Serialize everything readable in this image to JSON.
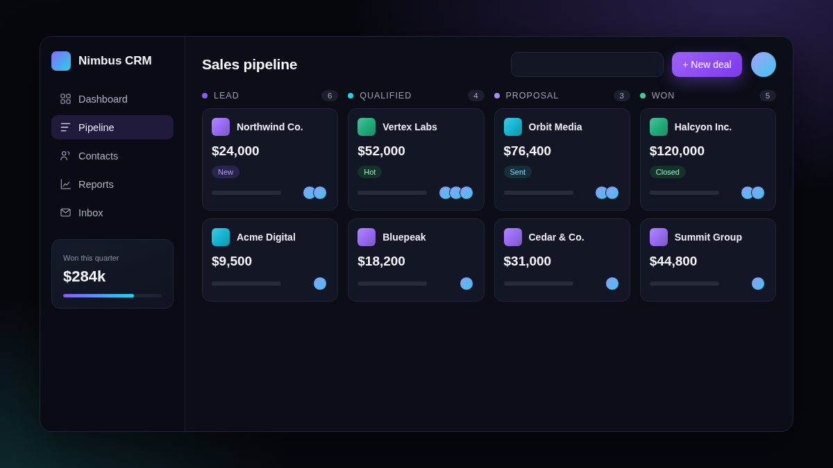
{
  "app": {
    "name": "Nimbus CRM"
  },
  "sidebar": {
    "items": [
      {
        "label": "Dashboard",
        "selected": false
      },
      {
        "label": "Pipeline",
        "selected": true
      },
      {
        "label": "Contacts",
        "selected": false
      },
      {
        "label": "Reports",
        "selected": false
      },
      {
        "label": "Inbox",
        "selected": false
      }
    ]
  },
  "stats": {
    "label": "Won this quarter",
    "value": "$284k",
    "level": 0.72
  },
  "header": {
    "title": "Sales pipeline",
    "button": "+ New deal"
  },
  "columns": [
    {
      "name": "LEAD",
      "color": "#8b5cf6",
      "count": "6",
      "deals": [
        {
          "company": "Northwind Co.",
          "color": "#9b6cf6",
          "amount": "$24,000",
          "tag": {
            "label": "New",
            "color": "#28244a"
          },
          "avatars": [
            {
              "kind": "gradient"
            },
            {
              "kind": "gradient"
            }
          ]
        },
        {
          "company": "Acme Digital",
          "color": "#16b8d4",
          "amount": "$9,500",
          "avatars": [
            {
              "kind": "gradient"
            }
          ]
        }
      ]
    },
    {
      "name": "QUALIFIED",
      "color": "#22d3ee",
      "count": "4",
      "deals": [
        {
          "company": "Vertex Labs",
          "color": "#22b07d",
          "amount": "$52,000",
          "tag": {
            "label": "Hot",
            "color": "#153229"
          },
          "avatars": [
            {
              "kind": "gradient"
            },
            {
              "kind": "gradient"
            },
            {
              "kind": "gradient"
            }
          ]
        },
        {
          "company": "Bluepeak",
          "color": "#9b6cf6",
          "amount": "$18,200",
          "avatars": [
            {
              "kind": "gradient"
            }
          ]
        }
      ]
    },
    {
      "name": "PROPOSAL",
      "color": "#a78bfa",
      "count": "3",
      "deals": [
        {
          "company": "Orbit Media",
          "color": "#16b8d4",
          "amount": "$76,400",
          "tag": {
            "label": "Sent",
            "color": "#14303b"
          },
          "avatars": [
            {
              "kind": "gradient"
            },
            {
              "kind": "gradient"
            }
          ]
        },
        {
          "company": "Cedar & Co.",
          "color": "#9b6cf6",
          "amount": "$31,000",
          "avatars": [
            {
              "kind": "gradient"
            }
          ]
        }
      ]
    },
    {
      "name": "WON",
      "color": "#34d399",
      "count": "5",
      "deals": [
        {
          "company": "Halcyon Inc.",
          "color": "#22b07d",
          "amount": "$120,000",
          "tag": {
            "label": "Closed",
            "color": "#153229"
          },
          "avatars": [
            {
              "kind": "gradient"
            },
            {
              "kind": "gradient"
            }
          ]
        },
        {
          "company": "Summit Group",
          "color": "#9b6cf6",
          "amount": "$44,800",
          "avatars": [
            {
              "kind": "gradient"
            }
          ]
        }
      ]
    }
  ]
}
